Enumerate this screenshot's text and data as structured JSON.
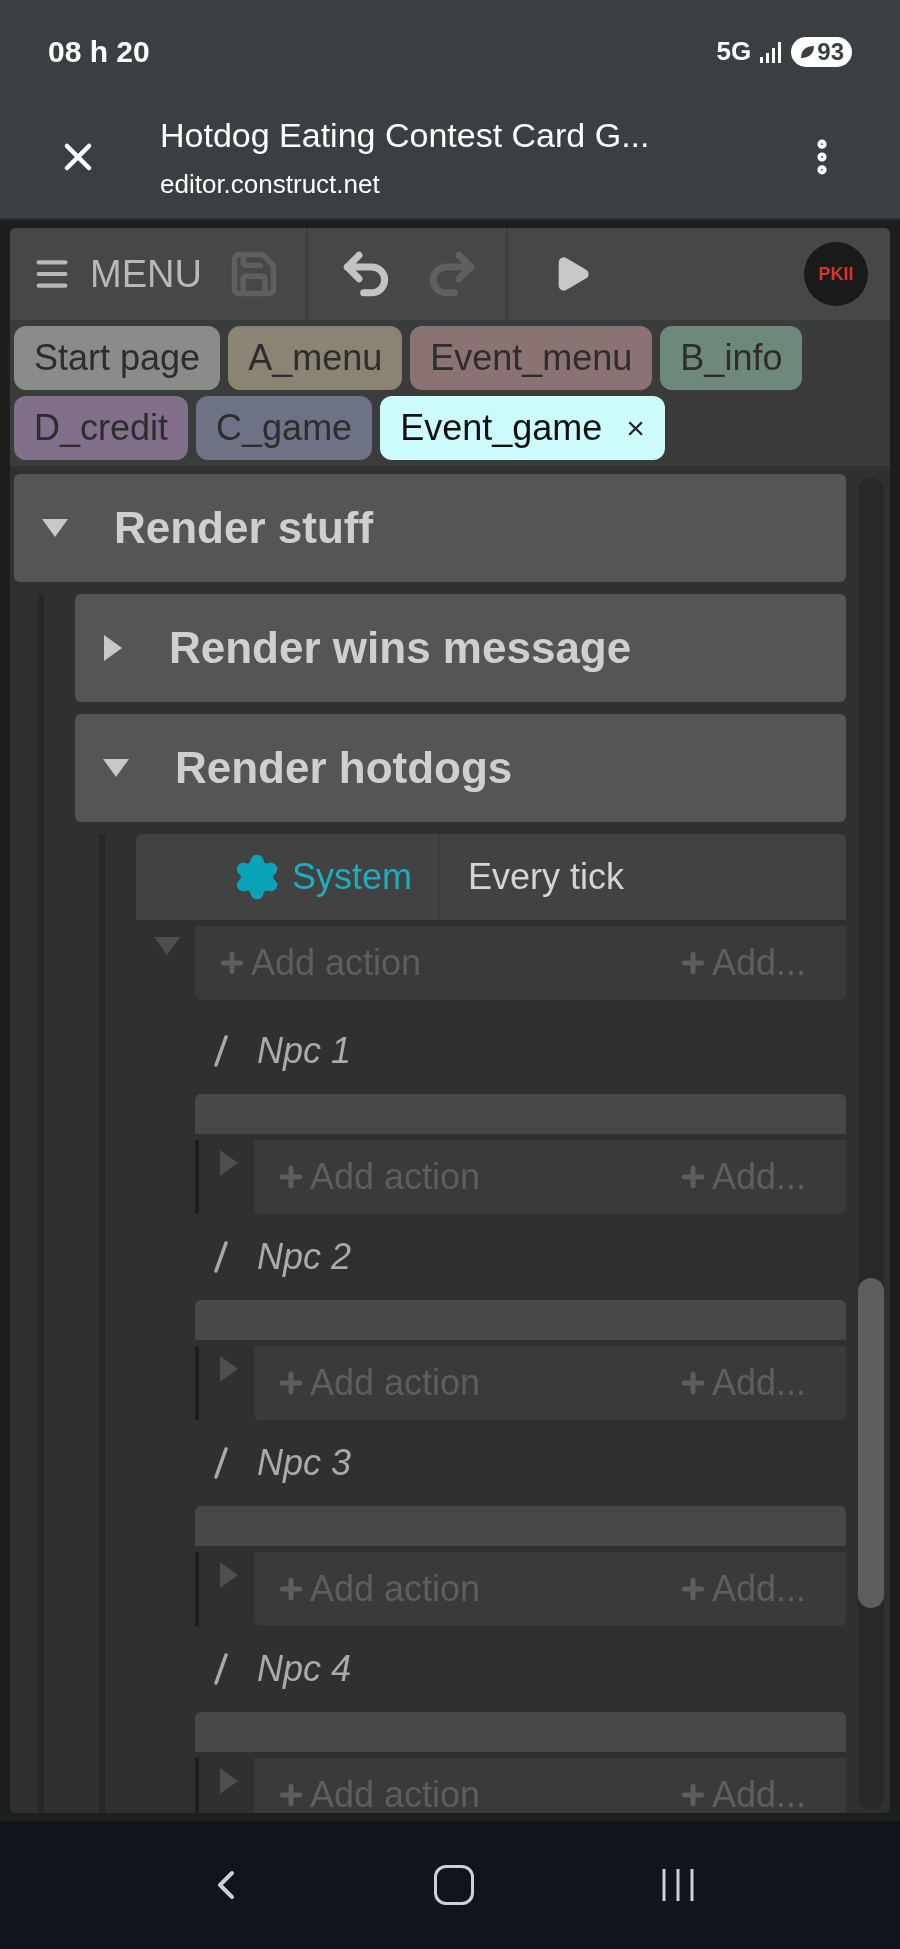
{
  "status_bar": {
    "time": "08 h 20",
    "network": "5G",
    "battery": "93"
  },
  "browser": {
    "title": "Hotdog Eating Contest Card G...",
    "url": "editor.construct.net"
  },
  "toolbar": {
    "menu_label": "MENU",
    "avatar": "PKII"
  },
  "tabs": [
    {
      "label": "Start page",
      "color": "#8a8c89",
      "selected": false
    },
    {
      "label": "A_menu",
      "color": "#8b8474",
      "selected": false
    },
    {
      "label": "Event_menu",
      "color": "#8a7473",
      "selected": false
    },
    {
      "label": "B_info",
      "color": "#6e897b",
      "selected": false
    },
    {
      "label": "D_credit",
      "color": "#82708a",
      "selected": false
    },
    {
      "label": "C_game",
      "color": "#6d7385",
      "selected": false
    },
    {
      "label": "Event_game",
      "color": "#cdfbfb",
      "selected": true,
      "close": "×"
    }
  ],
  "event_sheet": {
    "groups": [
      {
        "title": "Render stuff",
        "expanded": true,
        "children": [
          {
            "title": "Render wins message",
            "expanded": false
          },
          {
            "title": "Render hotdogs",
            "expanded": true,
            "events": [
              {
                "kind": "event",
                "expanded": true,
                "conditions": [
                  {
                    "object": "System",
                    "condition": "Every tick"
                  }
                ],
                "add_action": "Add action",
                "add_other": "Add...",
                "sub_events": [
                  {
                    "kind": "comment",
                    "text": "Npc 1"
                  },
                  {
                    "kind": "event",
                    "expanded": false,
                    "add_action": "Add action",
                    "add_other": "Add..."
                  },
                  {
                    "kind": "comment",
                    "text": "Npc 2"
                  },
                  {
                    "kind": "event",
                    "expanded": false,
                    "add_action": "Add action",
                    "add_other": "Add..."
                  },
                  {
                    "kind": "comment",
                    "text": "Npc 3"
                  },
                  {
                    "kind": "event",
                    "expanded": false,
                    "add_action": "Add action",
                    "add_other": "Add..."
                  },
                  {
                    "kind": "comment",
                    "text": "Npc 4"
                  },
                  {
                    "kind": "event",
                    "expanded": false,
                    "add_action": "Add action",
                    "add_other": "Add..."
                  }
                ]
              }
            ]
          }
        ]
      }
    ]
  }
}
